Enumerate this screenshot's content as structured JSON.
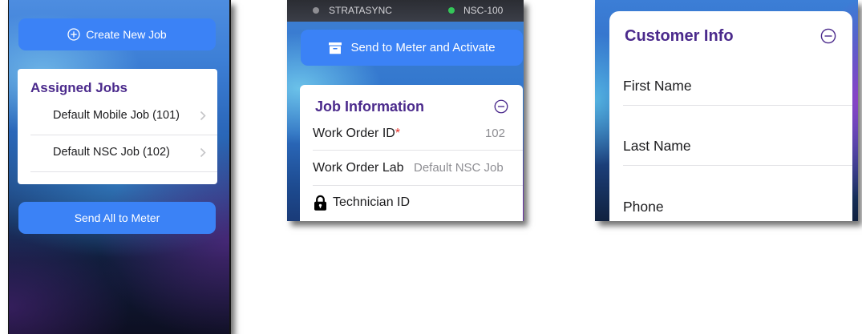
{
  "colors": {
    "accent_blue": "#3b82f6",
    "title_purple": "#4b2a8c",
    "required_red": "#e5302a",
    "divider": "#e2e2e6",
    "value_grey": "#8e8e93"
  },
  "jobs_screen": {
    "create_button": {
      "icon": "plus-circle-icon",
      "label": "Create New Job"
    },
    "assigned_jobs": {
      "title": "Assigned Jobs",
      "items": [
        {
          "label": "Default Mobile Job (101)",
          "icon": "chevron-right-icon"
        },
        {
          "label": "Default NSC Job (102)",
          "icon": "chevron-right-icon"
        }
      ]
    },
    "send_all_button": {
      "label": "Send All to Meter"
    }
  },
  "job_info_screen": {
    "status_bar": {
      "left": {
        "indicator_color": "#8e8e93",
        "label": "STRATASYNC"
      },
      "right": {
        "indicator_color": "#34c759",
        "label": "NSC-100"
      }
    },
    "activate_button": {
      "icon": "archive-box-icon",
      "label": "Send to Meter and Activate"
    },
    "card": {
      "title": "Job Information",
      "collapse_icon": "minus-circle-icon",
      "fields": [
        {
          "label": "Work Order ID",
          "required_mark": "*",
          "value": "102"
        },
        {
          "label": "Work Order Lab",
          "value": "Default NSC Job"
        },
        {
          "icon": "lock-icon",
          "label": "Technician ID"
        }
      ]
    }
  },
  "customer_screen": {
    "card": {
      "title": "Customer Info",
      "collapse_icon": "minus-circle-icon",
      "fields": [
        {
          "label": "First Name"
        },
        {
          "label": "Last Name"
        },
        {
          "label": "Phone"
        }
      ]
    }
  }
}
